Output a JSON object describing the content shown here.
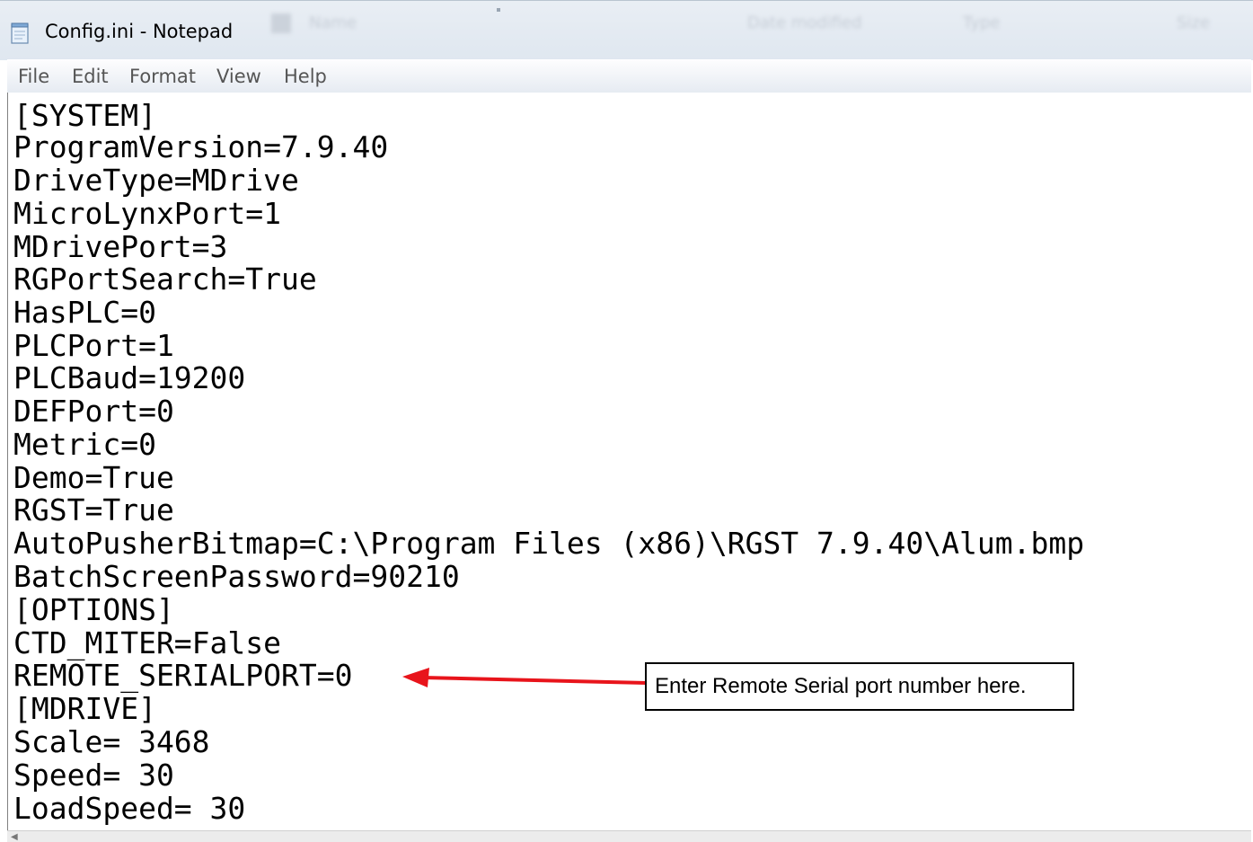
{
  "window": {
    "title": "Config.ini - Notepad"
  },
  "background_explorer": {
    "col_name": "Name",
    "col_date_modified": "Date modified",
    "col_type": "Type",
    "col_size": "Size"
  },
  "menu": {
    "file": "File",
    "edit": "Edit",
    "format": "Format",
    "view": "View",
    "help": "Help"
  },
  "document": {
    "lines": [
      "[SYSTEM]",
      "ProgramVersion=7.9.40",
      "DriveType=MDrive",
      "MicroLynxPort=1",
      "MDrivePort=3",
      "RGPortSearch=True",
      "HasPLC=0",
      "PLCPort=1",
      "PLCBaud=19200",
      "DEFPort=0",
      "Metric=0",
      "Demo=True",
      "RGST=True",
      "AutoPusherBitmap=C:\\Program Files (x86)\\RGST 7.9.40\\Alum.bmp",
      "BatchScreenPassword=90210",
      "[OPTIONS]",
      "CTD_MITER=False",
      "REMOTE_SERIALPORT=0",
      "[MDRIVE]",
      "Scale= 3468",
      "Speed= 30",
      "LoadSpeed= 30"
    ]
  },
  "annotation": {
    "callout_text": "Enter Remote Serial port number here.",
    "arrow_color": "#e8141b"
  },
  "colors": {
    "titlebar": "#dfe7f0",
    "menu_text": "#555555",
    "editor_bg": "#ffffff"
  }
}
